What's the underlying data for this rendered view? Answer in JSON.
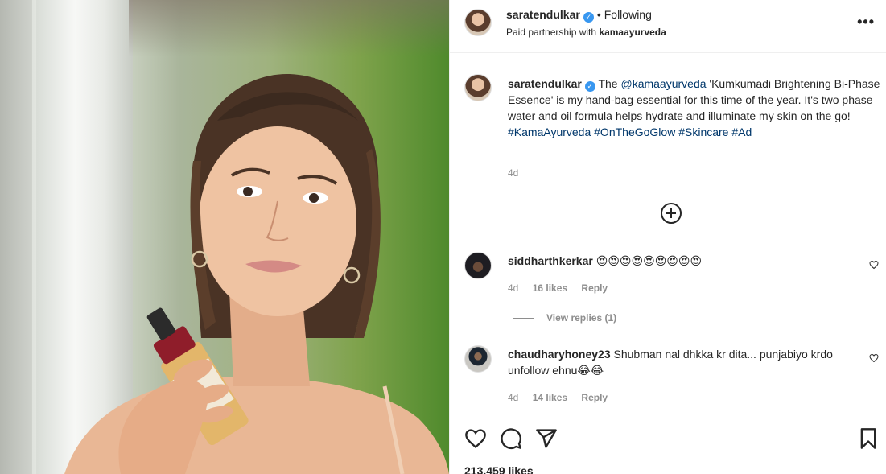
{
  "post": {
    "username": "saratendulkar",
    "follow_status": "Following",
    "dot": "•",
    "partnership_prefix": "Paid partnership with",
    "partner": "kamaayurveda",
    "more": "•••"
  },
  "caption": {
    "username": "saratendulkar",
    "text_before": "The ",
    "mention": "@kamaayurveda",
    "text_after": " 'Kumkumadi Brightening Bi-Phase Essence' is my hand-bag essential for this time of the year. It's two phase water and oil formula helps hydrate and illuminate my skin on the go!",
    "hashtags": [
      "#KamaAyurveda",
      "#OnTheGoGlow",
      "#Skincare",
      "#Ad"
    ],
    "time": "4d"
  },
  "comments": [
    {
      "username": "siddharthkerkar",
      "text": "😍😍😍😍😍😍😍😍😍",
      "time": "4d",
      "likes": "16 likes",
      "reply": "Reply"
    },
    {
      "username": "chaudharyhoney23",
      "text": "Shubman nal dhkka kr dita... punjabiyo krdo unfollow ehnu😂😂",
      "time": "4d",
      "likes": "14 likes",
      "reply": "Reply"
    }
  ],
  "view_replies": "View replies (1)",
  "likes_count": "213,459 likes",
  "colors": {
    "link": "#00376b",
    "verified": "#3897f0",
    "muted": "#8e8e8e"
  }
}
